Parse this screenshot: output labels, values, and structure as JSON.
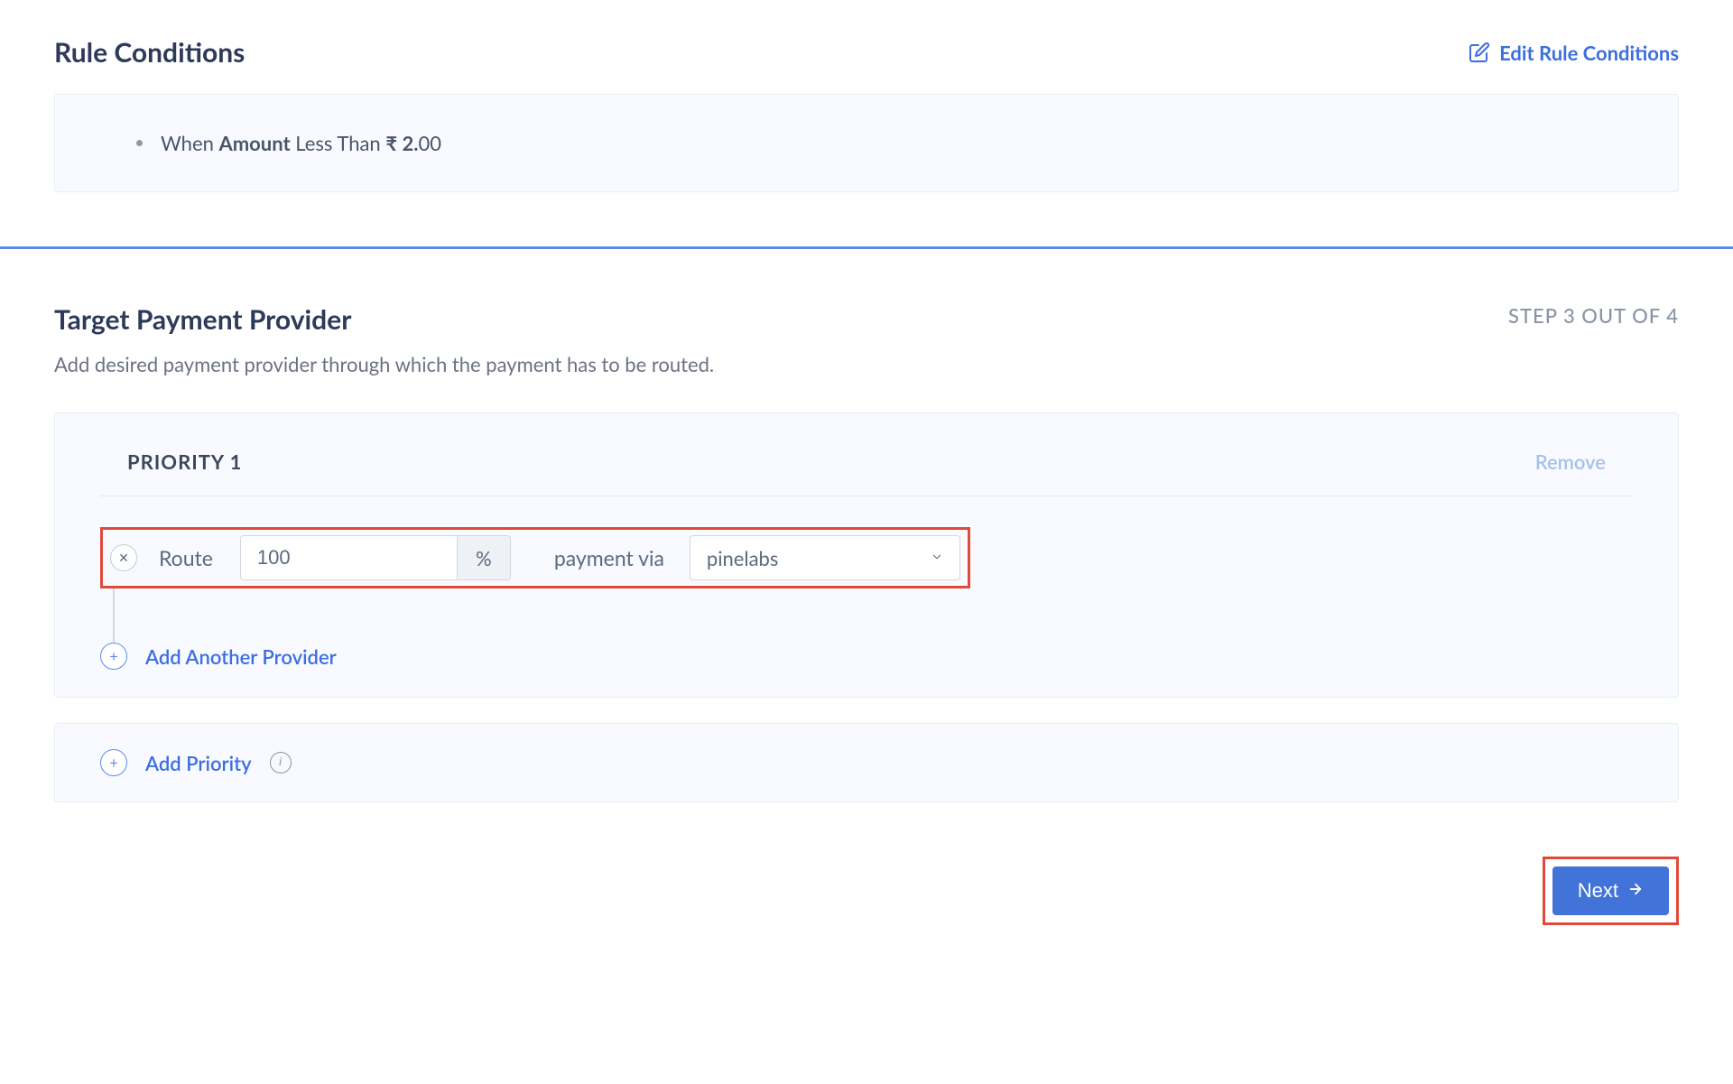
{
  "ruleConditions": {
    "title": "Rule Conditions",
    "editLabel": "Edit Rule Conditions",
    "whenPrefix": "When ",
    "field": "Amount",
    "operator": " Less Than ",
    "currencySymbol": "₹",
    "valueIntPart": " 2.",
    "valueDecPart": "00"
  },
  "target": {
    "title": "Target Payment Provider",
    "stepLabel": "STEP 3 OUT OF 4",
    "subtitle": "Add desired payment provider through which the payment has to be routed."
  },
  "priority": {
    "title": "PRIORITY 1",
    "removeLabel": "Remove",
    "routeLabel": "Route",
    "percentValue": "100",
    "percentSymbol": "%",
    "paymentViaLabel": "payment via",
    "providerValue": "pinelabs",
    "addAnotherLabel": "Add Another Provider"
  },
  "addPriorityLabel": "Add Priority",
  "nextLabel": "Next"
}
